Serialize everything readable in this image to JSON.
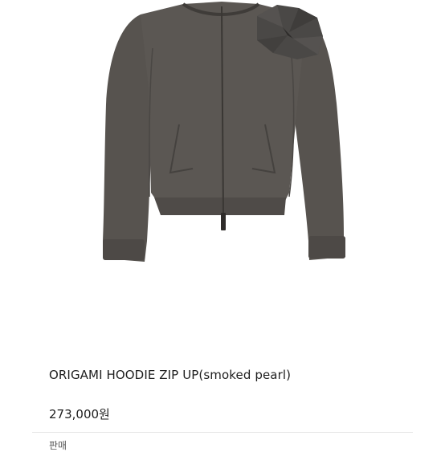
{
  "product": {
    "image_alt": "ORIGAMI HOODIE ZIP UP(smoked pearl)",
    "title": "ORIGAMI HOODIE ZIP UP(smoked pearl)",
    "price": "273,000원",
    "garment_color": "#57534f",
    "garment_shadow": "#3f3c39",
    "origami_color": "#4a4846"
  },
  "next_section": {
    "label": "판매"
  }
}
